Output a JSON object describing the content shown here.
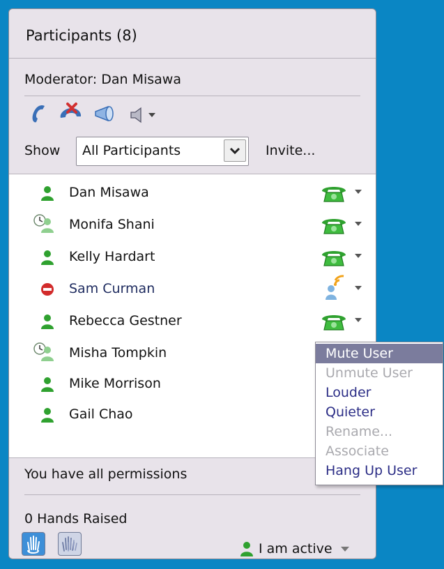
{
  "panel": {
    "title": "Participants (8)",
    "moderator": "Moderator:  Dan Misawa",
    "show_label": "Show",
    "show_value": "All Participants",
    "invite": "Invite..."
  },
  "toolbar": {
    "icons": [
      "phone-icon",
      "hang-up-icon",
      "megaphone-icon",
      "speaker-icon"
    ]
  },
  "participants": [
    {
      "name": "Dan Misawa",
      "status": "active",
      "line": "phone"
    },
    {
      "name": "Monifa Shani",
      "status": "away",
      "line": "phone"
    },
    {
      "name": "Kelly Hardart",
      "status": "active",
      "line": "phone"
    },
    {
      "name": "Sam Curman",
      "status": "blocked",
      "line": "speaking"
    },
    {
      "name": "Rebecca Gestner",
      "status": "active",
      "line": "phone"
    },
    {
      "name": "Misha Tompkin",
      "status": "away",
      "line": "none"
    },
    {
      "name": "Mike Morrison",
      "status": "active",
      "line": "none"
    },
    {
      "name": "Gail Chao",
      "status": "active",
      "line": "none"
    }
  ],
  "context_menu": {
    "items": [
      {
        "label": "Mute User",
        "state": "highlighted"
      },
      {
        "label": "Unmute User",
        "state": "disabled"
      },
      {
        "label": "Louder",
        "state": "enabled"
      },
      {
        "label": "Quieter",
        "state": "enabled"
      },
      {
        "label": "Rename...",
        "state": "disabled"
      },
      {
        "label": "Associate",
        "state": "disabled"
      },
      {
        "label": "Hang Up User",
        "state": "enabled"
      }
    ]
  },
  "footer": {
    "permissions": "You have all permissions",
    "hands": "0 Hands Raised",
    "status": "I am active"
  },
  "colors": {
    "background": "#0a86c4",
    "panel": "#e8e3ea",
    "menu_highlight": "#7b7c9d",
    "user_green": "#2fa12f",
    "blocked_red": "#d22b2b"
  }
}
